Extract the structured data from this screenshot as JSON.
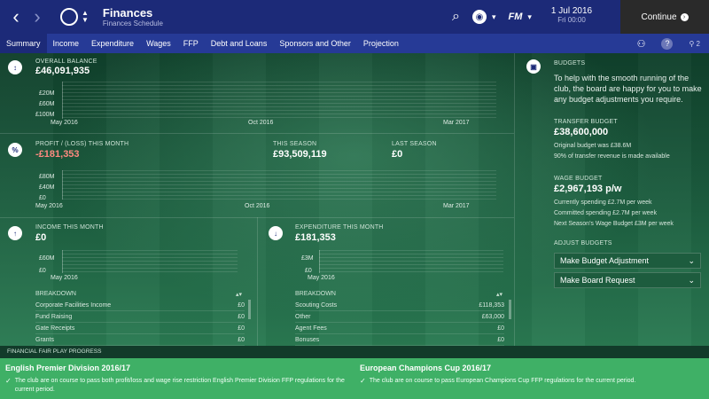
{
  "header": {
    "title": "Finances",
    "subtitle": "Finances Schedule",
    "badge": "",
    "date_main": "1 Jul 2016",
    "date_sub": "Fri 00:00",
    "fm_label": "FM",
    "continue_label": "Continue"
  },
  "tabs": [
    {
      "label": "Summary"
    },
    {
      "label": "Income"
    },
    {
      "label": "Expenditure"
    },
    {
      "label": "Wages"
    },
    {
      "label": "FFP"
    },
    {
      "label": "Debt and Loans"
    },
    {
      "label": "Sponsors and Other"
    },
    {
      "label": "Projection"
    }
  ],
  "tab_bar": {
    "user_label": "2"
  },
  "overall_balance": {
    "label": "OVERALL BALANCE",
    "value": "£46,091,935",
    "y_ticks": [
      "£20M",
      "£60M",
      "£100M"
    ],
    "x_ticks": [
      "May 2016",
      "Oct 2016",
      "Mar 2017"
    ]
  },
  "profit_loss": {
    "label": "PROFIT / (LOSS) THIS MONTH",
    "value": "-£181,353",
    "season_label": "THIS SEASON",
    "season_value": "£93,509,119",
    "last_label": "LAST SEASON",
    "last_value": "£0",
    "y_ticks": [
      "£80M",
      "£40M",
      "£0"
    ],
    "x_ticks": [
      "May 2016",
      "Oct 2016",
      "Mar 2017"
    ]
  },
  "income": {
    "label": "INCOME THIS MONTH",
    "value": "£0",
    "y_ticks": [
      "£60M",
      "£0"
    ],
    "x_tick": "May 2016",
    "breakdown_label": "BREAKDOWN",
    "rows": [
      {
        "name": "Corporate Facilities Income",
        "value": "£0"
      },
      {
        "name": "Fund Raising",
        "value": "£0"
      },
      {
        "name": "Gate Receipts",
        "value": "£0"
      },
      {
        "name": "Grants",
        "value": "£0"
      }
    ]
  },
  "expenditure": {
    "label": "EXPENDITURE THIS MONTH",
    "value": "£181,353",
    "y_ticks": [
      "£3M",
      "£0"
    ],
    "x_tick": "May 2016",
    "breakdown_label": "BREAKDOWN",
    "rows": [
      {
        "name": "Scouting Costs",
        "value": "£118,353"
      },
      {
        "name": "Other",
        "value": "£63,000"
      },
      {
        "name": "Agent Fees",
        "value": "£0"
      },
      {
        "name": "Bonuses",
        "value": "£0"
      }
    ]
  },
  "budgets": {
    "label": "BUDGETS",
    "text": "To help with the smooth running of the club, the board are happy for you to make any budget adjustments you require.",
    "transfer_label": "TRANSFER BUDGET",
    "transfer_value": "£38,600,000",
    "transfer_line1": "Original budget was £38.6M",
    "transfer_line2": "90% of transfer revenue is made available",
    "wage_label": "WAGE BUDGET",
    "wage_value": "£2,967,193 p/w",
    "wage_line1": "Currently spending £2.7M per week",
    "wage_line2": "Committed spending £2.7M per week",
    "wage_line3": "Next Season's Wage Budget £3M per week",
    "adjust_label": "ADJUST BUDGETS",
    "dropdown1": "Make Budget Adjustment",
    "dropdown2": "Make Board Request"
  },
  "ffp": {
    "strip_label": "FINANCIAL FAIR PLAY PROGRESS",
    "left_title": "English Premier Division 2016/17",
    "left_msg": "The club are on course to pass both profit/loss and wage rise restriction English Premier Division FFP regulations for the current period.",
    "right_title": "European Champions Cup 2016/17",
    "right_msg": "The club are on course to pass European Champions Cup FFP regulations for the current period."
  },
  "colors": {
    "top_bar": "#1c2a78",
    "tab_bar": "#263a96",
    "ffp_green": "#3fb066",
    "loss_red": "#ff8a80"
  }
}
